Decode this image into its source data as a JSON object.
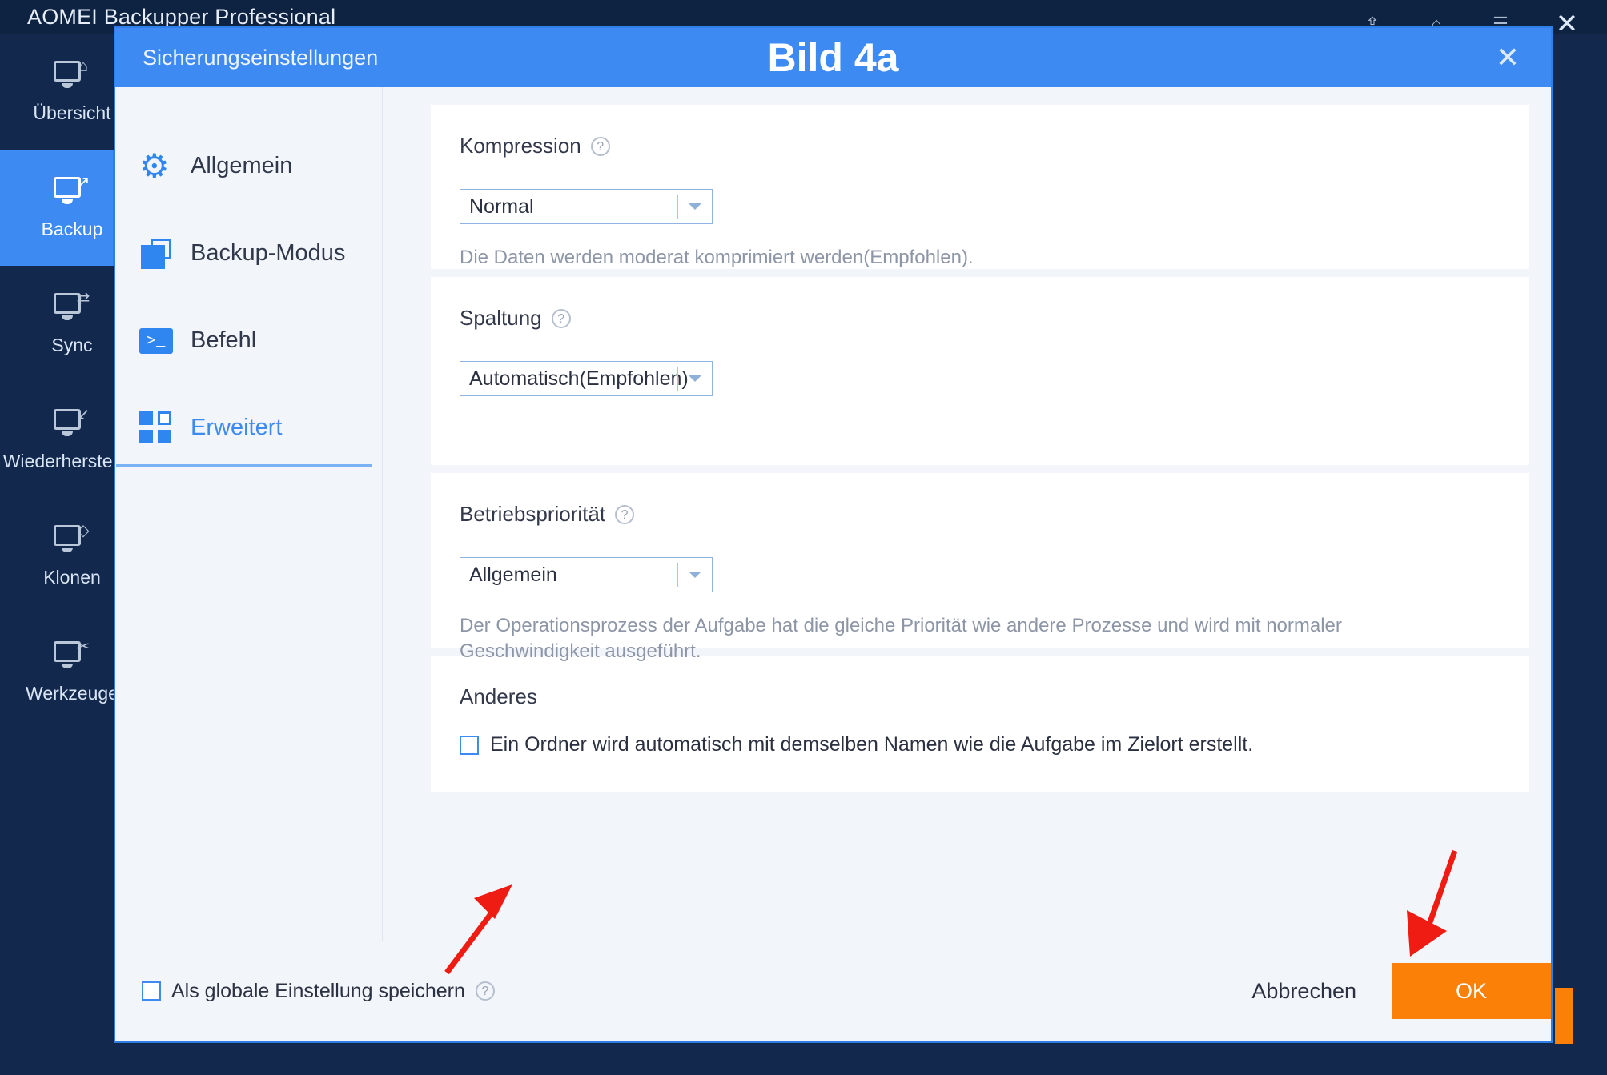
{
  "app": {
    "title": "AOMEI Backupper Professional",
    "window_controls": [
      {
        "name": "upgrade-icon",
        "glyph": "⇪"
      },
      {
        "name": "home-icon",
        "glyph": "⌂"
      },
      {
        "name": "menu-icon",
        "glyph": "☰"
      }
    ],
    "close_label": "✕",
    "nav": [
      {
        "label": "Übersicht",
        "icon": "home-monitor-icon",
        "badge": "⌂",
        "active": false
      },
      {
        "label": "Backup",
        "icon": "backup-monitor-icon",
        "badge": "↗",
        "active": true
      },
      {
        "label": "Sync",
        "icon": "sync-monitor-icon",
        "badge": "⇄",
        "active": false
      },
      {
        "label": "Wiederherstellen",
        "icon": "restore-monitor-icon",
        "badge": "↙",
        "active": false
      },
      {
        "label": "Klonen",
        "icon": "clone-monitor-icon",
        "badge": "◇",
        "active": false
      },
      {
        "label": "Werkzeuge",
        "icon": "tools-monitor-icon",
        "badge": "✂",
        "active": false
      }
    ]
  },
  "dialog": {
    "titlebar_label": "Sicherungseinstellungen",
    "heading": "Bild 4a",
    "close_label": "✕",
    "tabs": [
      {
        "label": "Allgemein",
        "icon": "gear-icon",
        "active": false
      },
      {
        "label": "Backup-Modus",
        "icon": "layers-icon",
        "active": false
      },
      {
        "label": "Befehl",
        "icon": "console-icon",
        "active": false
      },
      {
        "label": "Erweitert",
        "icon": "grid-icon",
        "active": true
      }
    ],
    "console_glyph": ">_",
    "help_glyph": "?",
    "cards": [
      {
        "label": "Kompression",
        "has_help": true,
        "select_value": "Normal",
        "description": "Die Daten werden moderat komprimiert werden(Empfohlen)."
      },
      {
        "label": "Spaltung",
        "has_help": true,
        "select_value": "Automatisch(Empfohlen)",
        "description": ""
      },
      {
        "label": "Betriebspriorität",
        "has_help": true,
        "select_value": "Allgemein",
        "description": "Der Operationsprozess der Aufgabe hat die gleiche Priorität wie andere Prozesse und wird mit normaler Geschwindigkeit ausgeführt."
      }
    ],
    "other_section": {
      "label": "Anderes",
      "checkbox_label": "Ein Ordner wird automatisch mit demselben Namen wie die Aufgabe im Zielort erstellt.",
      "checked": false
    },
    "footer": {
      "global_setting_label": "Als globale Einstellung speichern",
      "global_setting_checked": false,
      "cancel_label": "Abbrechen",
      "ok_label": "OK"
    }
  },
  "colors": {
    "accent_blue": "#3d8bf2",
    "dark_navy": "#12294d",
    "titlebar_navy": "#0e2342",
    "orange": "#fa8008",
    "annotation_red": "#ee1c12",
    "panel_bg": "#f2f5fa",
    "card_bg": "#ffffff"
  }
}
